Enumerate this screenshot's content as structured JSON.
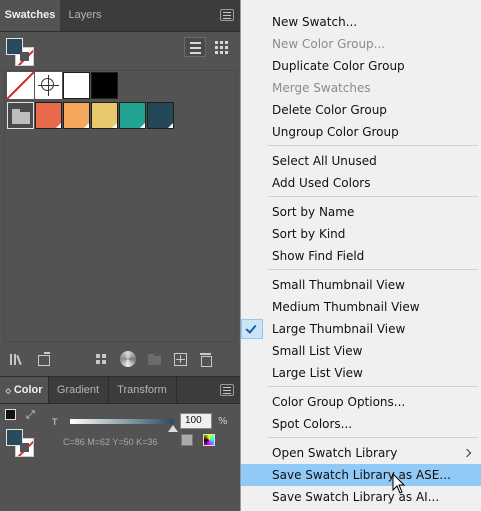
{
  "swatches_panel": {
    "tabs": [
      {
        "label": "Swatches",
        "active": true
      },
      {
        "label": "Layers",
        "active": false
      }
    ],
    "fill_color": "#2a4a5e",
    "swatches": [
      {
        "type": "none",
        "name": "none-swatch"
      },
      {
        "type": "registration",
        "name": "registration-swatch"
      },
      {
        "type": "color",
        "hex": "#ffffff"
      },
      {
        "type": "color",
        "hex": "#000000"
      },
      {
        "type": "folder",
        "name": "color-group-folder"
      },
      {
        "type": "color",
        "hex": "#e86a4b"
      },
      {
        "type": "color",
        "hex": "#f3a85b"
      },
      {
        "type": "color",
        "hex": "#eac96d"
      },
      {
        "type": "color",
        "hex": "#23a391"
      },
      {
        "type": "color",
        "hex": "#254859"
      }
    ],
    "bottom_tools": [
      "swatch-libraries-icon",
      "place-swatches-icon",
      "show-swatch-kinds-icon",
      "color-group-icon",
      "new-color-group-icon",
      "new-swatch-icon",
      "delete-swatch-icon"
    ]
  },
  "color_panel": {
    "tabs": [
      {
        "label": "Color",
        "active": true
      },
      {
        "label": "Gradient",
        "active": false
      },
      {
        "label": "Transform",
        "active": false
      }
    ],
    "tint_label": "T",
    "tint_value": "100",
    "tint_unit": "%",
    "cmyk_readout": "C=86 M=62 Y=50 K=36"
  },
  "menu": {
    "items": [
      {
        "label": "New Swatch...",
        "disabled": false
      },
      {
        "label": "New Color Group...",
        "disabled": true
      },
      {
        "label": "Duplicate Color Group",
        "disabled": false
      },
      {
        "label": "Merge Swatches",
        "disabled": true
      },
      {
        "label": "Delete Color Group",
        "disabled": false
      },
      {
        "label": "Ungroup Color Group",
        "disabled": false
      },
      {
        "separator": true
      },
      {
        "label": "Select All Unused",
        "disabled": false
      },
      {
        "label": "Add Used Colors",
        "disabled": false
      },
      {
        "separator": true
      },
      {
        "label": "Sort by Name",
        "disabled": false
      },
      {
        "label": "Sort by Kind",
        "disabled": false
      },
      {
        "label": "Show Find Field",
        "disabled": false
      },
      {
        "separator": true
      },
      {
        "label": "Small Thumbnail View",
        "disabled": false
      },
      {
        "label": "Medium Thumbnail View",
        "disabled": false
      },
      {
        "label": "Large Thumbnail View",
        "disabled": false,
        "checked": true
      },
      {
        "label": "Small List View",
        "disabled": false
      },
      {
        "label": "Large List View",
        "disabled": false
      },
      {
        "separator": true
      },
      {
        "label": "Color Group Options...",
        "disabled": false
      },
      {
        "label": "Spot Colors...",
        "disabled": false
      },
      {
        "separator": true
      },
      {
        "label": "Open Swatch Library",
        "disabled": false,
        "submenu": true
      },
      {
        "label": "Save Swatch Library as ASE...",
        "disabled": false,
        "highlighted": true
      },
      {
        "label": "Save Swatch Library as AI...",
        "disabled": false
      }
    ]
  }
}
